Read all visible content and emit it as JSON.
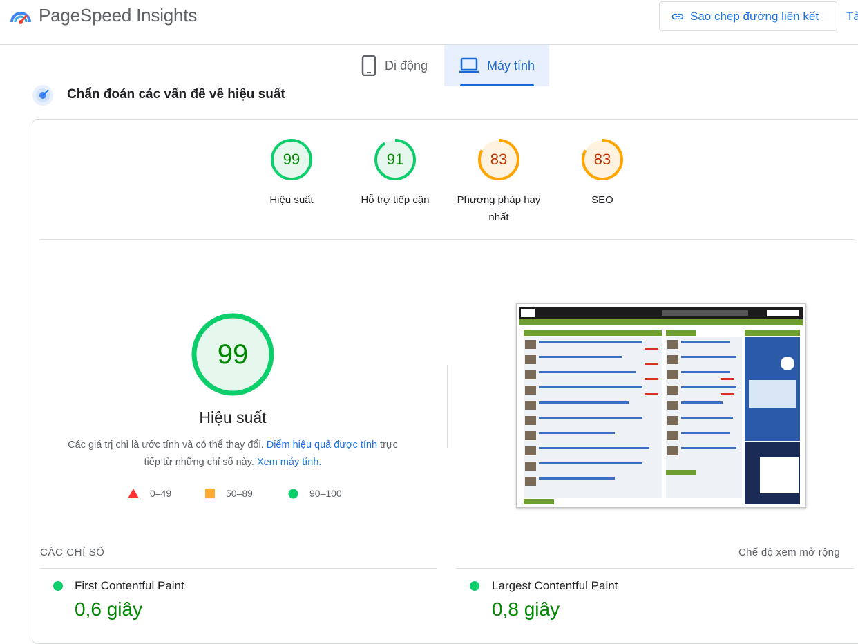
{
  "header": {
    "app_title": "PageSpeed Insights",
    "copy_link_label": "Sao chép đường liên kết",
    "cut_label": "Tả"
  },
  "tabs": [
    {
      "label": "Di động",
      "icon": "phone-icon",
      "selected": false
    },
    {
      "label": "Máy tính",
      "icon": "laptop-icon",
      "selected": true
    }
  ],
  "section": {
    "title": "Chẩn đoán các vấn đề về hiệu suất"
  },
  "scores": [
    {
      "value": "99",
      "label": "Hiệu suất",
      "status": "pass"
    },
    {
      "value": "91",
      "label": "Hỗ trợ tiếp cận",
      "status": "pass"
    },
    {
      "value": "83",
      "label": "Phương pháp hay nhất",
      "status": "average"
    },
    {
      "value": "83",
      "label": "SEO",
      "status": "average"
    }
  ],
  "performance": {
    "score": "99",
    "label": "Hiệu suất",
    "desc_part1": "Các giá trị chỉ là ước tính và có thể thay đổi.",
    "desc_link1": "Điểm hiệu quả được tính",
    "desc_part2": "trực tiếp từ những chỉ số này.",
    "desc_link2": "Xem máy tính."
  },
  "legend": [
    {
      "range": "0–49",
      "shape": "triangle",
      "color": "#ff3333"
    },
    {
      "range": "50–89",
      "shape": "square",
      "color": "#ffaa33"
    },
    {
      "range": "90–100",
      "shape": "circle",
      "color": "#0cce6b"
    }
  ],
  "metrics": {
    "title": "CÁC CHỈ SỐ",
    "expand_label": "Chế độ xem mở rộng",
    "items": [
      {
        "name": "First Contentful Paint",
        "value": "0,6 giây"
      },
      {
        "name": "Largest Contentful Paint",
        "value": "0,8 giây"
      }
    ]
  },
  "colors": {
    "pass": "#0cce6b",
    "pass_text": "#008800",
    "average": "#ffa400",
    "average_text": "#c33300",
    "accent": "#1a73e8"
  }
}
